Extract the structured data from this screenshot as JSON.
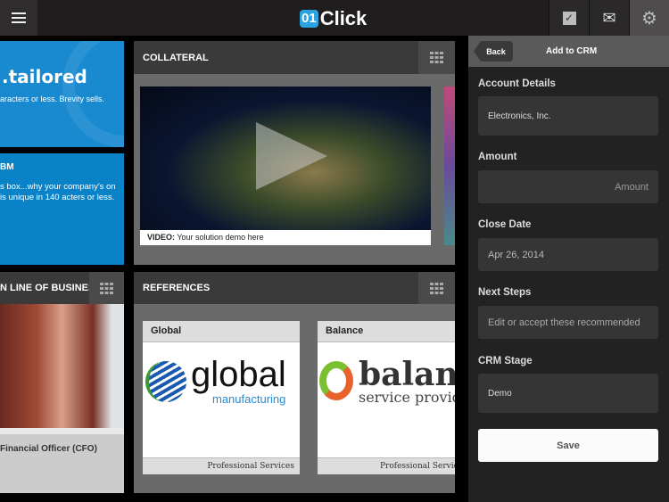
{
  "header": {
    "logo_badge": "01",
    "logo_text": "Click",
    "icons": [
      "menu-icon",
      "checkbox-icon",
      "mail-icon",
      "gear-icon"
    ]
  },
  "tiles": {
    "tailored_title": ".tailored",
    "tailored_text": "aracters or less. Brevity sells.",
    "bm_title": "BM",
    "bm_text": "s box...why your company's on is unique in 140 acters or less."
  },
  "collateral": {
    "title": "COLLATERAL",
    "video_caption_bold": "VIDEO:",
    "video_caption": " Your solution demo here"
  },
  "line_of_business": {
    "title": "N LINE OF BUSINESS",
    "caption": "Financial Officer (CFO)"
  },
  "references": {
    "title": "REFERENCES",
    "cards": [
      {
        "name": "Global",
        "logo_main": "global",
        "logo_sub": "manufacturing",
        "footer": "Professional Services"
      },
      {
        "name": "Balance",
        "logo_main": "balanc",
        "logo_sub": "service provid",
        "footer": "Professional Servic"
      }
    ]
  },
  "crm": {
    "back": "Back",
    "title": "Add to CRM",
    "account_label": "Account Details",
    "account_value": "Electronics, Inc.",
    "amount_label": "Amount",
    "amount_placeholder": "Amount",
    "close_label": "Close Date",
    "close_value": "Apr 26, 2014",
    "steps_label": "Next Steps",
    "steps_value": "Edit or accept these recommended",
    "stage_label": "CRM Stage",
    "stage_value": "Demo",
    "save": "Save"
  },
  "colors": {
    "brand_blue": "#1a8ad0",
    "logo_blue": "#2aa3e0"
  }
}
